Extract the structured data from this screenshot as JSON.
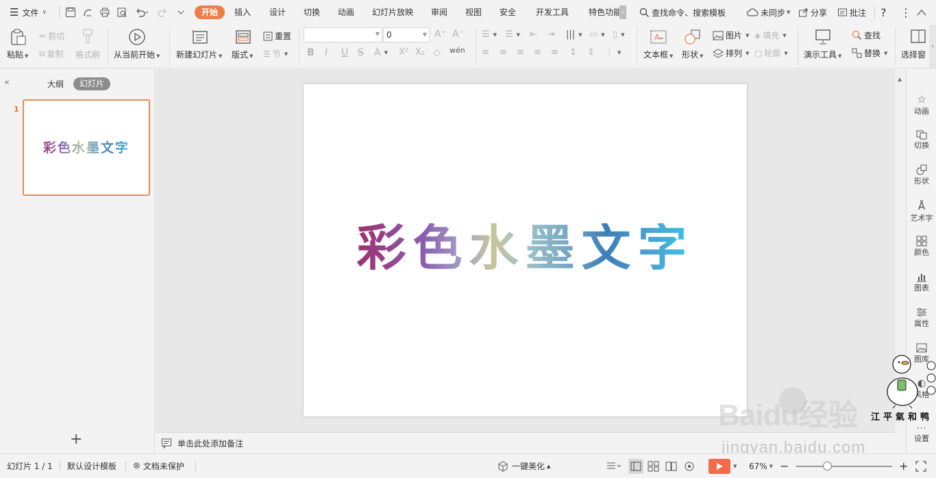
{
  "titlebar": {
    "file_menu": "文件",
    "tabs": [
      "开始",
      "插入",
      "设计",
      "切换",
      "动画",
      "幻灯片放映",
      "审阅",
      "视图",
      "安全",
      "开发工具",
      "特色功能"
    ],
    "search": "查找命令、搜索模板",
    "sync": "未同步",
    "share": "分享",
    "comment": "批注"
  },
  "ribbon": {
    "paste": "粘贴",
    "cut": "剪切",
    "copy": "复制",
    "format_painter": "格式刷",
    "play_from_current": "从当前开始",
    "new_slide": "新建幻灯片",
    "layout": "版式",
    "reset": "重置",
    "section": "节",
    "font_size": "0",
    "textbox": "文本框",
    "shape": "形状",
    "picture": "图片",
    "fill": "填充",
    "arrange": "排列",
    "outline": "轮廓",
    "present_tools": "演示工具",
    "find": "查找",
    "replace": "替换",
    "select_pane": "选择窗"
  },
  "left_panel": {
    "tab_outline": "大纲",
    "tab_slides": "幻灯片",
    "slide_number": "1",
    "add": "+"
  },
  "slide": {
    "title": "彩色水墨文字"
  },
  "notes": {
    "placeholder": "单击此处添加备注"
  },
  "right_sidebar": [
    "动画",
    "切换",
    "形状",
    "艺术字",
    "颜色",
    "图表",
    "属性",
    "图库",
    "风格",
    "设置"
  ],
  "status": {
    "slide_info": "幻灯片 1 / 1",
    "template": "默认设计模板",
    "protect": "文档未保护",
    "beautify": "一键美化",
    "zoom": "67%"
  },
  "watermark": {
    "brand": "Baidu经验",
    "url": "jingyan.baidu.com",
    "sticker_text": "江平氣和鸭"
  },
  "colors": {
    "accent": "#f07d47",
    "play": "#f26b4a"
  }
}
